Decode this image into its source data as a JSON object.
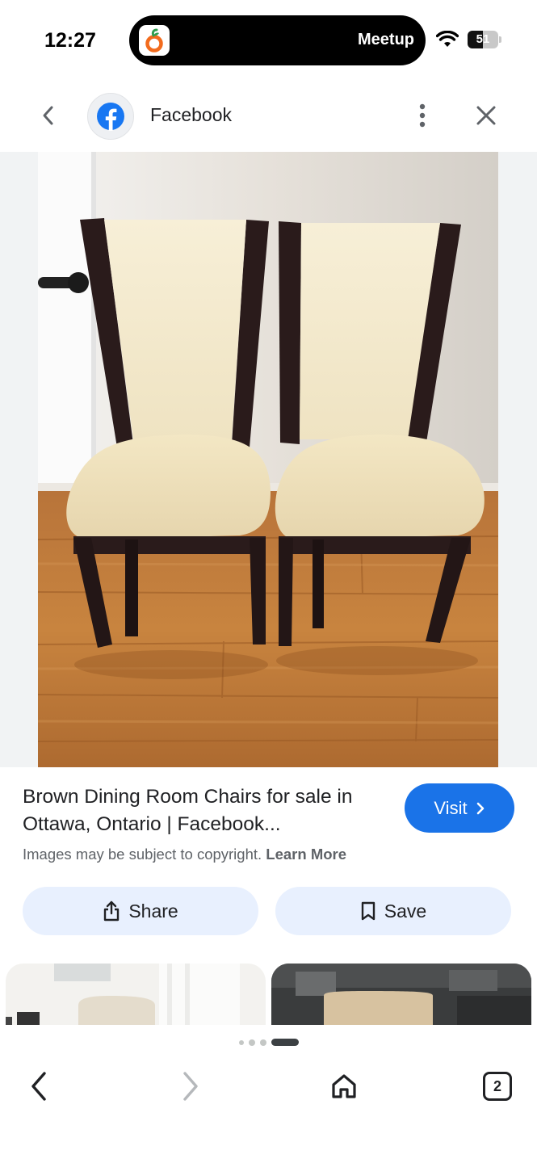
{
  "status_bar": {
    "time": "12:27",
    "live_activity_app": "Meetup",
    "live_activity_icon": "orange-app-icon",
    "battery": "51",
    "battery_level_pct": 51
  },
  "header": {
    "source_name": "Facebook",
    "back_icon": "chevron-left-icon",
    "more_icon": "more-vert-icon",
    "close_icon": "close-icon"
  },
  "result": {
    "title": "Brown Dining Room Chairs for sale in Ottawa, Ontario | Facebook...",
    "visit_label": "Visit",
    "copyright_text": "Images may be subject to copyright.",
    "learn_more": "Learn More",
    "share_label": "Share",
    "save_label": "Save"
  },
  "carousel": {
    "page_count": 4,
    "active_index": 3
  },
  "bottom_nav": {
    "tab_count": "2"
  },
  "colors": {
    "accent": "#1a73e8",
    "action_button_bg": "#e8f0fe",
    "facebook_blue": "#1877f2"
  }
}
